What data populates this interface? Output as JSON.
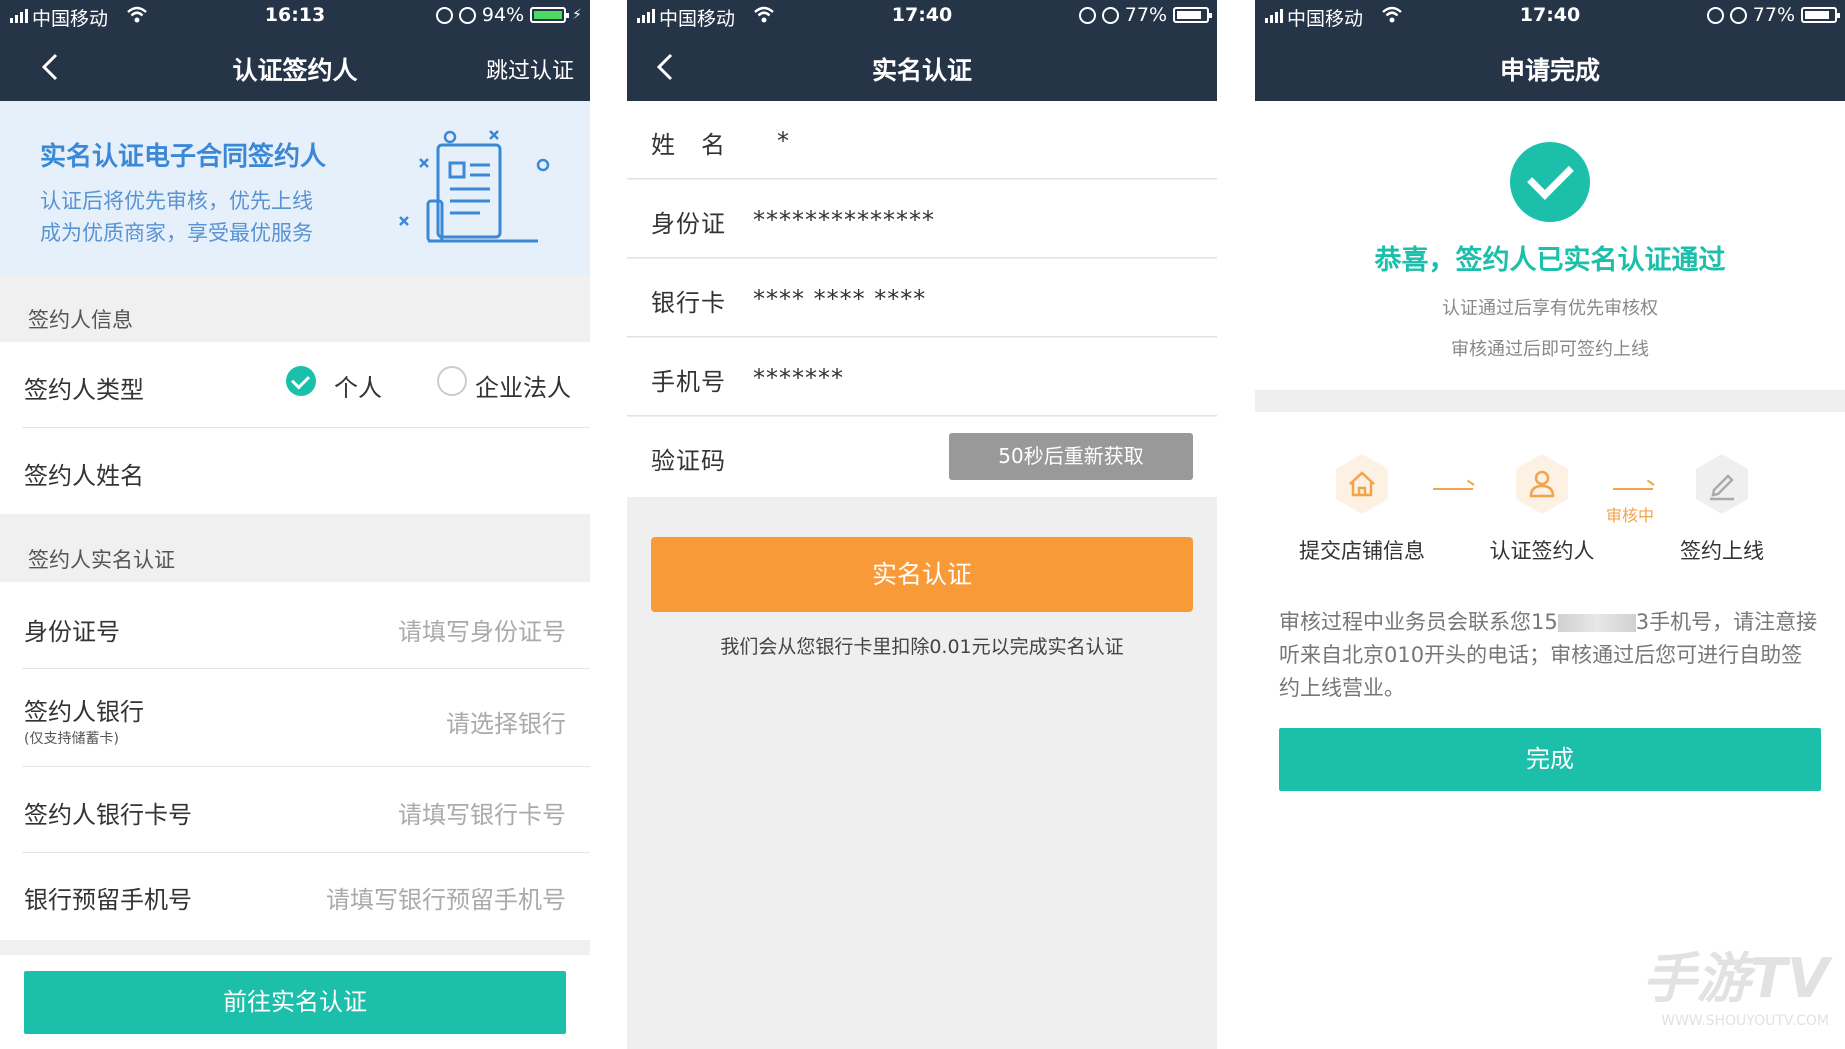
{
  "screen1": {
    "status": {
      "carrier": "中国移动",
      "time": "16:13",
      "battery": "94%"
    },
    "nav": {
      "title": "认证签约人",
      "skip": "跳过认证"
    },
    "banner": {
      "heading": "实名认证电子合同签约人",
      "line1": "认证后将优先审核，优先上线",
      "line2": "成为优质商家，享受最优服务"
    },
    "section_info": "签约人信息",
    "signer_type_label": "签约人类型",
    "option_personal": "个人",
    "option_company": "企业法人",
    "signer_name_label": "签约人姓名",
    "section_realname": "签约人实名认证",
    "id_label": "身份证号",
    "id_placeholder": "请填写身份证号",
    "bank_label": "签约人银行",
    "bank_hint": "(仅支持储蓄卡)",
    "bank_placeholder": "请选择银行",
    "card_label": "签约人银行卡号",
    "card_placeholder": "请填写银行卡号",
    "phone_label": "银行预留手机号",
    "phone_placeholder": "请填写银行预留手机号",
    "submit": "前往实名认证"
  },
  "screen2": {
    "status": {
      "carrier": "中国移动",
      "time": "17:40",
      "battery": "77%"
    },
    "nav": {
      "title": "实名认证"
    },
    "name_label": "姓　名",
    "name_value": "*",
    "id_label": "身份证",
    "id_value": "**************",
    "card_label": "银行卡",
    "card_value": "**** **** ****",
    "phone_label": "手机号",
    "phone_value": "*******",
    "code_label": "验证码",
    "resend": "50秒后重新获取",
    "submit": "实名认证",
    "note": "我们会从您银行卡里扣除0.01元以完成实名认证"
  },
  "screen3": {
    "status": {
      "carrier": "中国移动",
      "time": "17:40",
      "battery": "77%"
    },
    "nav": {
      "title": "申请完成"
    },
    "title": "恭喜，签约人已实名认证通过",
    "sub1": "认证通过后享有优先审核权",
    "sub2": "审核通过后即可签约上线",
    "step1": "提交店铺信息",
    "step2": "认证签约人",
    "step3": "签约上线",
    "audit": "审核中",
    "para_a": "审核过程中业务员会联系您15",
    "para_b": "3手机号，请注意接听来自北京010开头的电话；审核通过后您可进行自助签约上线营业。",
    "done": "完成",
    "watermark": "手游TV",
    "watermark_url": "WWW.SHOUYOUTV.COM"
  },
  "colors": {
    "nav": "#263448",
    "teal": "#1cbfa9",
    "orange": "#f99a38",
    "step_orange": "#f3a34a"
  },
  "battery_levels": {
    "screen1": 0.94,
    "screen2": 0.77,
    "screen3": 0.77
  }
}
